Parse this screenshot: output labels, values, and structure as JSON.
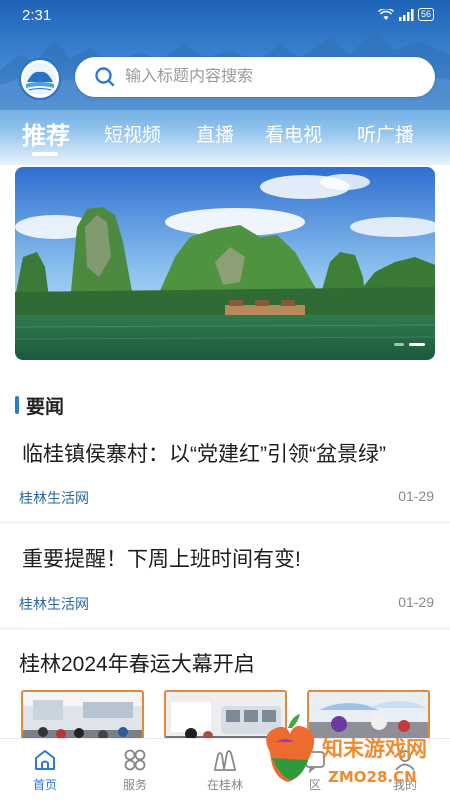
{
  "status_bar": {
    "time": "2:31",
    "battery": "56"
  },
  "search": {
    "placeholder": "输入标题内容搜索"
  },
  "tabs": [
    {
      "label": "推荐",
      "active": true
    },
    {
      "label": "短视频"
    },
    {
      "label": "直播"
    },
    {
      "label": "看电视"
    },
    {
      "label": "听广播"
    }
  ],
  "banner": {
    "slides": 2,
    "active_slide": 2
  },
  "section": {
    "title": "要闻"
  },
  "news": [
    {
      "title": "临桂镇侯寨村：以“党建红”引领“盆景绿”",
      "source": "桂林生活网",
      "date": "01-29"
    },
    {
      "title": "重要提醒！下周上班时间有变!",
      "source": "桂林生活网",
      "date": "01-29"
    },
    {
      "title": "桂林2024年春运大幕开启"
    }
  ],
  "bottom_nav": [
    {
      "label": "首页",
      "icon": "home-icon",
      "active": true
    },
    {
      "label": "服务",
      "icon": "grid-icon"
    },
    {
      "label": "在桂林",
      "icon": "hills-icon"
    },
    {
      "label": "区",
      "icon": "community-icon"
    },
    {
      "label": "我的",
      "icon": "user-icon"
    }
  ],
  "watermark": {
    "text": "知末游戏网",
    "url": "ZMO28.CN"
  },
  "colors": {
    "accent": "#2b7ad6",
    "source_text": "#2b68a8",
    "header_top": "#1f63b8"
  }
}
